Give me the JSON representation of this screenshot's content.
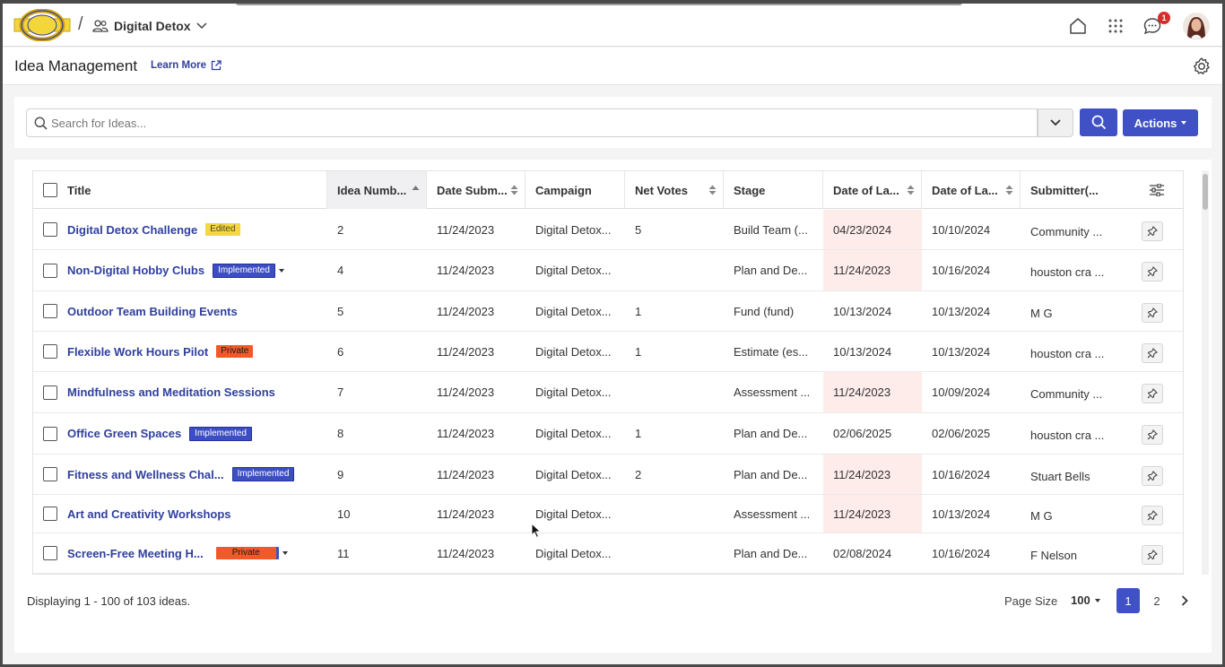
{
  "header": {
    "workspace": "Digital Detox",
    "separator": "/",
    "notification_count": "1"
  },
  "subheader": {
    "title": "Idea Management",
    "learn_more": "Learn More"
  },
  "search": {
    "placeholder": "Search for Ideas...",
    "actions_label": "Actions"
  },
  "columns": {
    "title": "Title",
    "idea_number": "Idea Numb...",
    "date_submitted": "Date Subm...",
    "campaign": "Campaign",
    "net_votes": "Net Votes",
    "stage": "Stage",
    "date_last_1": "Date of La...",
    "date_last_2": "Date of La...",
    "submitter": "Submitter(..."
  },
  "rows": [
    {
      "title": "Digital Detox Challenge",
      "tag": "Edited",
      "number": "2",
      "date": "11/24/2023",
      "campaign": "Digital Detox...",
      "votes": "5",
      "stage": "Build Team (...",
      "last1": "04/23/2024",
      "last2": "10/10/2024",
      "submitter": "Community  ..."
    },
    {
      "title": "Non-Digital Hobby Clubs",
      "tag": "Implemented",
      "number": "4",
      "date": "11/24/2023",
      "campaign": "Digital Detox...",
      "votes": "",
      "stage": "Plan and De...",
      "last1": "11/24/2023",
      "last2": "10/16/2024",
      "submitter": "houston cra ..."
    },
    {
      "title": "Outdoor Team Building Events",
      "tag": "",
      "number": "5",
      "date": "11/24/2023",
      "campaign": "Digital Detox...",
      "votes": "1",
      "stage": "Fund (fund)",
      "last1": "10/13/2024",
      "last2": "10/13/2024",
      "submitter": "M G"
    },
    {
      "title": "Flexible Work Hours Pilot",
      "tag": "Private",
      "number": "6",
      "date": "11/24/2023",
      "campaign": "Digital Detox...",
      "votes": "1",
      "stage": "Estimate (es...",
      "last1": "10/13/2024",
      "last2": "10/13/2024",
      "submitter": "houston cra ..."
    },
    {
      "title": "Mindfulness and Meditation Sessions",
      "tag": "",
      "number": "7",
      "date": "11/24/2023",
      "campaign": "Digital Detox...",
      "votes": "",
      "stage": "Assessment ...",
      "last1": "11/24/2023",
      "last2": "10/09/2024",
      "submitter": "Community  ..."
    },
    {
      "title": "Office Green Spaces",
      "tag": "Implemented",
      "number": "8",
      "date": "11/24/2023",
      "campaign": "Digital Detox...",
      "votes": "1",
      "stage": "Plan and De...",
      "last1": "02/06/2025",
      "last2": "02/06/2025",
      "submitter": "houston cra ..."
    },
    {
      "title": "Fitness and Wellness Chal...",
      "tag": "Implemented",
      "number": "9",
      "date": "11/24/2023",
      "campaign": "Digital Detox...",
      "votes": "2",
      "stage": "Plan and De...",
      "last1": "11/24/2023",
      "last2": "10/16/2024",
      "submitter": "Stuart Bells"
    },
    {
      "title": "Art and Creativity Workshops",
      "tag": "",
      "number": "10",
      "date": "11/24/2023",
      "campaign": "Digital Detox...",
      "votes": "",
      "stage": "Assessment ...",
      "last1": "11/24/2023",
      "last2": "10/13/2024",
      "submitter": "M G"
    },
    {
      "title": "Screen-Free Meeting H...",
      "tag": "Private",
      "number": "11",
      "date": "11/24/2023",
      "campaign": "Digital Detox...",
      "votes": "",
      "stage": "Plan and De...",
      "last1": "02/08/2024",
      "last2": "10/16/2024",
      "submitter": "F Nelson"
    }
  ],
  "footer": {
    "display_text": "Displaying 1 - 100 of 103 ideas.",
    "page_size_label": "Page Size",
    "page_size": "100",
    "pages": [
      "1",
      "2"
    ]
  },
  "colors": {
    "accent": "#3f51c4",
    "link": "#2f3f9e",
    "highlight_cell": "#fdecea",
    "tag_edited": "#f5d742",
    "tag_private": "#f05a28"
  }
}
